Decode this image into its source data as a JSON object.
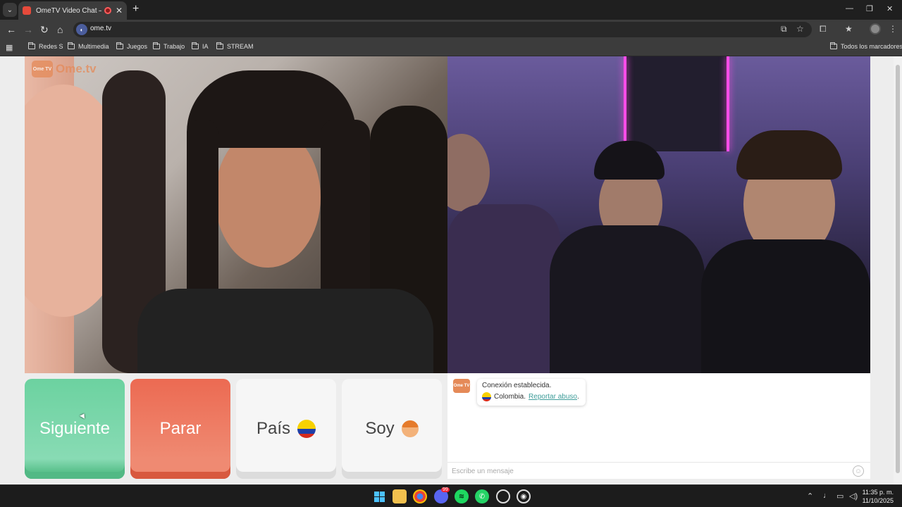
{
  "browser": {
    "tab_title": "OmeTV Video Chat — Omegle",
    "url": "ome.tv",
    "bookmarks": [
      "Redes S",
      "Multimedia",
      "Juegos",
      "Trabajo",
      "IA",
      "STREAM"
    ],
    "all_bookmarks": "Todos los marcadores"
  },
  "site": {
    "brand": "Ome.tv",
    "logo_badge": "Ome TV"
  },
  "controls": {
    "next": "Siguiente",
    "stop": "Parar",
    "country": "País",
    "gender": "Soy"
  },
  "chat": {
    "status": "Conexión establecida.",
    "country": "Colombia.",
    "report": "Reportar abuso",
    "report_suffix": ".",
    "placeholder": "Escribe un mensaje"
  },
  "taskbar": {
    "time": "11:35 p. m.",
    "date": "11/10/2025",
    "discord_badge": "99"
  },
  "colors": {
    "next": "#6cd2a0",
    "stop": "#ec6a52",
    "brand": "#e58a58",
    "link": "#3f9d9a"
  }
}
